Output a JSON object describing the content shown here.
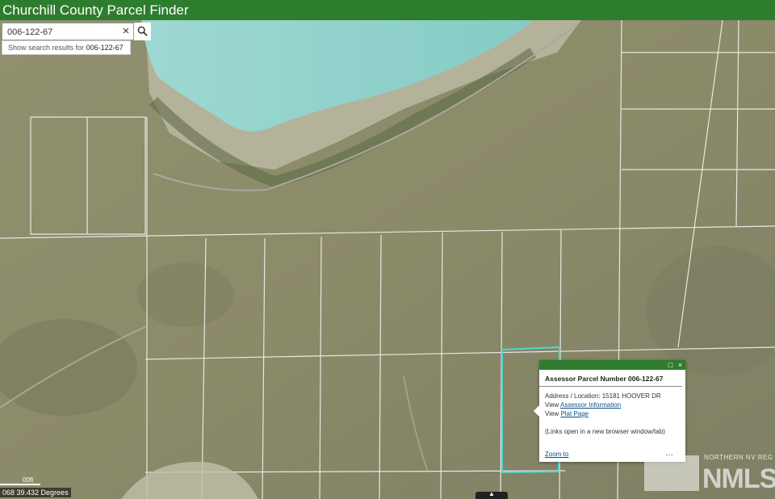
{
  "header": {
    "title": "Churchill County Parcel Finder"
  },
  "search": {
    "value": "006-122-67",
    "clear_label": "×"
  },
  "suggestion": {
    "prefix": "Show search results for",
    "term": "006-122-67"
  },
  "popup": {
    "title": "Assessor Parcel Number 006-122-67",
    "address_label": "Address / Location:",
    "address_value": "15181 HOOVER DR",
    "view_label": "View",
    "assessor_link": "Assessor Information",
    "plat_link": "Plat Page",
    "note": "(Links open in a new browser window/tab)",
    "zoom_link": "Zoom to",
    "more": "…",
    "maximize": "□",
    "close": "×"
  },
  "map": {
    "coords": "068 39.432 Degrees",
    "scale_label": "00ft",
    "logo_small": "NORTHERN NV REG",
    "logo_big": "NMLS",
    "handle_icon": "▲",
    "colors": {
      "terrain": "#8a8a6c",
      "water": "#8fd3cc",
      "parcel_highlight": "#4dd6d6",
      "header": "#2e7d2e"
    }
  }
}
